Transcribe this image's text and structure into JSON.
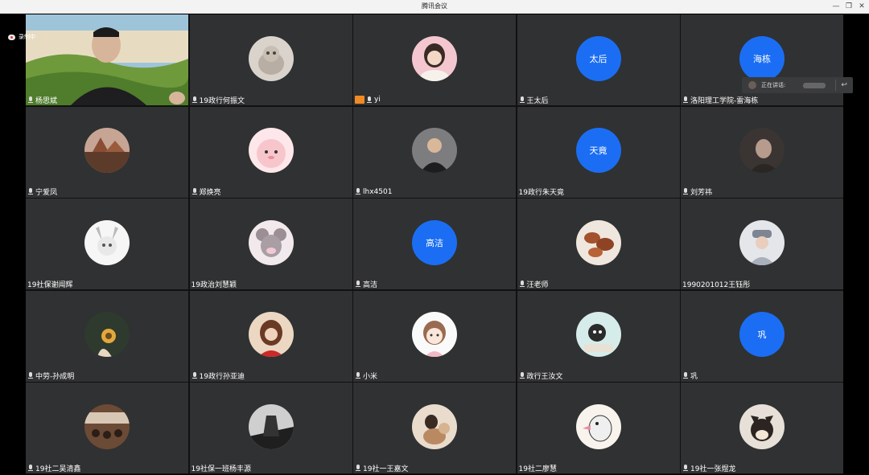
{
  "window": {
    "title": "腾讯会议",
    "minimize": "—",
    "restore": "❐",
    "close": "✕"
  },
  "recording": {
    "label": "录制中"
  },
  "speaking_panel": {
    "label": "正在讲话:",
    "back_icon": "reply-icon"
  },
  "colors": {
    "tile_bg": "#303132",
    "avatar_blue": "#1b6ef3",
    "badge_orange": "#f08a24"
  },
  "participants": [
    {
      "name": "杨思斌",
      "mic": "on",
      "kind": "video"
    },
    {
      "name": "19政行何振文",
      "mic": "muted",
      "kind": "photo",
      "photo": "cat"
    },
    {
      "name": "yi",
      "mic": "muted",
      "kind": "photo",
      "photo": "girl",
      "badge": true
    },
    {
      "name": "王太后",
      "mic": "muted",
      "kind": "text",
      "avatar_text": "太后"
    },
    {
      "name": "洛阳理工学院-雷海栋",
      "mic": "muted",
      "kind": "text",
      "avatar_text": "海栋"
    },
    {
      "name": "宁爱凤",
      "mic": "muted",
      "kind": "photo",
      "photo": "sunset"
    },
    {
      "name": "郑焕亮",
      "mic": "muted",
      "kind": "photo",
      "photo": "pink"
    },
    {
      "name": "lhx4501",
      "mic": "muted",
      "kind": "photo",
      "photo": "man"
    },
    {
      "name": "19政行朱天竟",
      "mic": "none",
      "kind": "text",
      "avatar_text": "天竟"
    },
    {
      "name": "刘芳祎",
      "mic": "muted",
      "kind": "photo",
      "photo": "dark"
    },
    {
      "name": "19社保谢闻辉",
      "mic": "none",
      "kind": "photo",
      "photo": "anime"
    },
    {
      "name": "19政治刘慧颖",
      "mic": "none",
      "kind": "photo",
      "photo": "mouse"
    },
    {
      "name": "高洁",
      "mic": "muted",
      "kind": "text",
      "avatar_text": "高洁"
    },
    {
      "name": "汪老师",
      "mic": "muted",
      "kind": "photo",
      "photo": "leaves"
    },
    {
      "name": "1990201012王钰彤",
      "mic": "none",
      "kind": "photo",
      "photo": "hat"
    },
    {
      "name": "中劳-孙成明",
      "mic": "muted",
      "kind": "photo",
      "photo": "sunflower"
    },
    {
      "name": "19政行孙亚迪",
      "mic": "muted",
      "kind": "photo",
      "photo": "redgirl"
    },
    {
      "name": "小米",
      "mic": "muted",
      "kind": "photo",
      "photo": "cartoon"
    },
    {
      "name": "政行王汝文",
      "mic": "muted",
      "kind": "photo",
      "photo": "sketch"
    },
    {
      "name": "巩",
      "mic": "muted",
      "kind": "text",
      "avatar_text": "巩"
    },
    {
      "name": "19社二吴清鑫",
      "mic": "muted",
      "kind": "photo",
      "photo": "crowd"
    },
    {
      "name": "19社保一班杨丰源",
      "mic": "none",
      "kind": "photo",
      "photo": "bw"
    },
    {
      "name": "19社一王嘉文",
      "mic": "muted",
      "kind": "photo",
      "photo": "dog"
    },
    {
      "name": "19社二廖慧",
      "mic": "none",
      "kind": "photo",
      "photo": "bird"
    },
    {
      "name": "19社一张煜龙",
      "mic": "muted",
      "kind": "photo",
      "photo": "shiba"
    }
  ]
}
